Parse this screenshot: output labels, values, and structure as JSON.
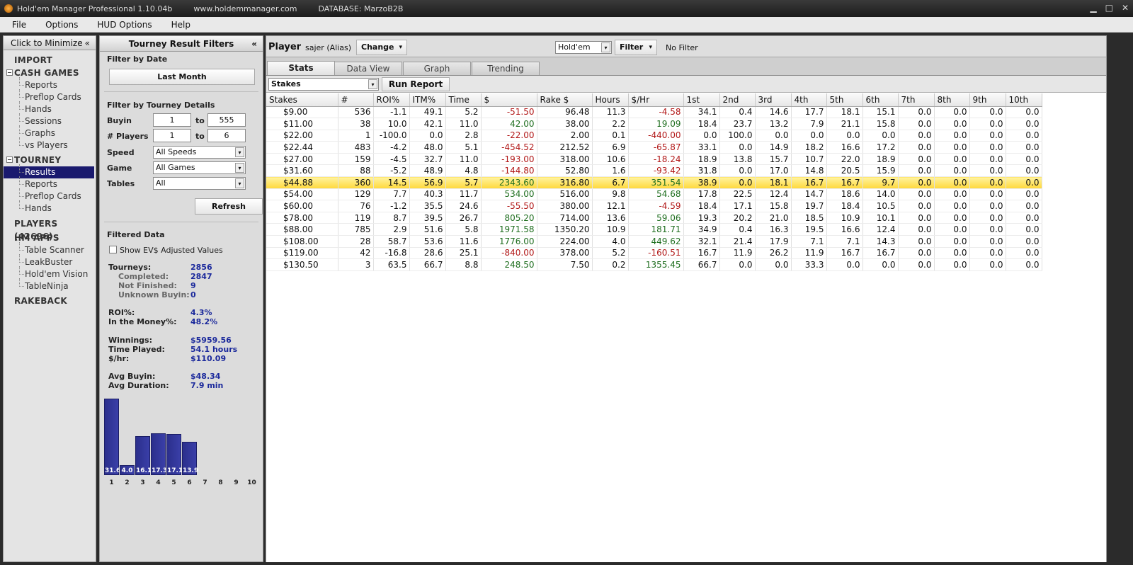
{
  "titlebar": {
    "app_title": "Hold'em Manager Professional 1.10.04b",
    "website": "www.holdemmanager.com",
    "database": "DATABASE: MarzoB2B",
    "minimize": "▁",
    "maximize": "□",
    "close": "✕"
  },
  "menu": [
    "File",
    "Options",
    "HUD Options",
    "Help"
  ],
  "nav": {
    "minimize_label": "Click to Minimize",
    "minimize_glyph": "«",
    "import": "IMPORT",
    "cash_games": "CASH GAMES",
    "cash_items": [
      "Reports",
      "Preflop Cards",
      "Hands",
      "Sessions",
      "Graphs",
      "vs Players"
    ],
    "tourney": "TOURNEY",
    "tourney_items": [
      "Results",
      "Reports",
      "Preflop Cards",
      "Hands"
    ],
    "players": "PLAYERS (42696)",
    "hm_apps": "HM APPS",
    "app_items": [
      "Table Scanner",
      "LeakBuster",
      "Hold'em Vision",
      "TableNinja"
    ],
    "rakeback": "RAKEBACK",
    "expander_glyph": "−"
  },
  "filters": {
    "title": "Tourney Result Filters",
    "collapse_glyph": "«",
    "by_date_label": "Filter by Date",
    "date_button": "Last Month",
    "by_details_label": "Filter by Tourney Details",
    "buyin_label": "Buyin",
    "buyin_from": "1",
    "buyin_to": "555",
    "to_label": "to",
    "players_label": "# Players",
    "players_from": "1",
    "players_to": "6",
    "speed_label": "Speed",
    "speed_value": "All Speeds",
    "game_label": "Game",
    "game_value": "All Games",
    "tables_label": "Tables",
    "tables_value": "All",
    "refresh": "Refresh",
    "filtered_data_label": "Filtered Data",
    "ev_checkbox_label": "Show EV$ Adjusted Values",
    "stats": {
      "tourneys_label": "Tourneys:",
      "tourneys": "2856",
      "completed_label": "Completed:",
      "completed": "2847",
      "not_finished_label": "Not Finished:",
      "not_finished": "9",
      "unknown_label": "Unknown Buyin:",
      "unknown": "0",
      "roi_label": "ROI%:",
      "roi": "4.3%",
      "itm_label": "In the Money%:",
      "itm": "48.2%",
      "winnings_label": "Winnings:",
      "winnings": "$5959.56",
      "time_label": "Time Played:",
      "time": "54.1 hours",
      "hr_label": "$/hr:",
      "hr": "$110.09",
      "avg_buyin_label": "Avg Buyin:",
      "avg_buyin": "$48.34",
      "avg_dur_label": "Avg Duration:",
      "avg_dur": "7.9 min"
    }
  },
  "chart_data": {
    "type": "bar",
    "categories": [
      "1",
      "2",
      "3",
      "4",
      "5",
      "6",
      "7",
      "8",
      "9",
      "10"
    ],
    "values": [
      31.6,
      4.0,
      16.1,
      17.3,
      17.1,
      13.9,
      0,
      0,
      0,
      0
    ],
    "labels": [
      "31.6",
      "4.0",
      "16.1",
      "17.3",
      "17.1",
      "13.9",
      "",
      "",
      "",
      ""
    ],
    "ylim": [
      0,
      31.6
    ]
  },
  "player": {
    "label": "Player",
    "alias": "sajer (Alias)",
    "change_button": "Change",
    "game_type": "Hold'em",
    "filter_button": "Filter",
    "filter_status": "No Filter",
    "dd_glyph": "▾"
  },
  "tabs": [
    "Stats",
    "Data View",
    "Graph",
    "Trending"
  ],
  "report": {
    "type": "Stakes",
    "run_button": "Run Report"
  },
  "table": {
    "columns": [
      "Stakes",
      "#",
      "ROI%",
      "ITM%",
      "Time",
      "$",
      "Rake $",
      "Hours",
      "$/Hr",
      "1st",
      "2nd",
      "3rd",
      "4th",
      "5th",
      "6th",
      "7th",
      "8th",
      "9th",
      "10th"
    ],
    "rows": [
      [
        "$9.00",
        "536",
        "-1.1",
        "49.1",
        "5.2",
        "-51.50",
        "96.48",
        "11.3",
        "-4.58",
        "34.1",
        "0.4",
        "14.6",
        "17.7",
        "18.1",
        "15.1",
        "0.0",
        "0.0",
        "0.0",
        "0.0"
      ],
      [
        "$11.00",
        "38",
        "10.0",
        "42.1",
        "11.0",
        "42.00",
        "38.00",
        "2.2",
        "19.09",
        "18.4",
        "23.7",
        "13.2",
        "7.9",
        "21.1",
        "15.8",
        "0.0",
        "0.0",
        "0.0",
        "0.0"
      ],
      [
        "$22.00",
        "1",
        "-100.0",
        "0.0",
        "2.8",
        "-22.00",
        "2.00",
        "0.1",
        "-440.00",
        "0.0",
        "100.0",
        "0.0",
        "0.0",
        "0.0",
        "0.0",
        "0.0",
        "0.0",
        "0.0",
        "0.0"
      ],
      [
        "$22.44",
        "483",
        "-4.2",
        "48.0",
        "5.1",
        "-454.52",
        "212.52",
        "6.9",
        "-65.87",
        "33.1",
        "0.0",
        "14.9",
        "18.2",
        "16.6",
        "17.2",
        "0.0",
        "0.0",
        "0.0",
        "0.0"
      ],
      [
        "$27.00",
        "159",
        "-4.5",
        "32.7",
        "11.0",
        "-193.00",
        "318.00",
        "10.6",
        "-18.24",
        "18.9",
        "13.8",
        "15.7",
        "10.7",
        "22.0",
        "18.9",
        "0.0",
        "0.0",
        "0.0",
        "0.0"
      ],
      [
        "$31.60",
        "88",
        "-5.2",
        "48.9",
        "4.8",
        "-144.80",
        "52.80",
        "1.6",
        "-93.42",
        "31.8",
        "0.0",
        "17.0",
        "14.8",
        "20.5",
        "15.9",
        "0.0",
        "0.0",
        "0.0",
        "0.0"
      ],
      [
        "$44.88",
        "360",
        "14.5",
        "56.9",
        "5.7",
        "2343.60",
        "316.80",
        "6.7",
        "351.54",
        "38.9",
        "0.0",
        "18.1",
        "16.7",
        "16.7",
        "9.7",
        "0.0",
        "0.0",
        "0.0",
        "0.0"
      ],
      [
        "$54.00",
        "129",
        "7.7",
        "40.3",
        "11.7",
        "534.00",
        "516.00",
        "9.8",
        "54.68",
        "17.8",
        "22.5",
        "12.4",
        "14.7",
        "18.6",
        "14.0",
        "0.0",
        "0.0",
        "0.0",
        "0.0"
      ],
      [
        "$60.00",
        "76",
        "-1.2",
        "35.5",
        "24.6",
        "-55.50",
        "380.00",
        "12.1",
        "-4.59",
        "18.4",
        "17.1",
        "15.8",
        "19.7",
        "18.4",
        "10.5",
        "0.0",
        "0.0",
        "0.0",
        "0.0"
      ],
      [
        "$78.00",
        "119",
        "8.7",
        "39.5",
        "26.7",
        "805.20",
        "714.00",
        "13.6",
        "59.06",
        "19.3",
        "20.2",
        "21.0",
        "18.5",
        "10.9",
        "10.1",
        "0.0",
        "0.0",
        "0.0",
        "0.0"
      ],
      [
        "$88.00",
        "785",
        "2.9",
        "51.6",
        "5.8",
        "1971.58",
        "1350.20",
        "10.9",
        "181.71",
        "34.9",
        "0.4",
        "16.3",
        "19.5",
        "16.6",
        "12.4",
        "0.0",
        "0.0",
        "0.0",
        "0.0"
      ],
      [
        "$108.00",
        "28",
        "58.7",
        "53.6",
        "11.6",
        "1776.00",
        "224.00",
        "4.0",
        "449.62",
        "32.1",
        "21.4",
        "17.9",
        "7.1",
        "7.1",
        "14.3",
        "0.0",
        "0.0",
        "0.0",
        "0.0"
      ],
      [
        "$119.00",
        "42",
        "-16.8",
        "28.6",
        "25.1",
        "-840.00",
        "378.00",
        "5.2",
        "-160.51",
        "16.7",
        "11.9",
        "26.2",
        "11.9",
        "16.7",
        "16.7",
        "0.0",
        "0.0",
        "0.0",
        "0.0"
      ],
      [
        "$130.50",
        "3",
        "63.5",
        "66.7",
        "8.8",
        "248.50",
        "7.50",
        "0.2",
        "1355.45",
        "66.7",
        "0.0",
        "0.0",
        "33.3",
        "0.0",
        "0.0",
        "0.0",
        "0.0",
        "0.0",
        "0.0"
      ]
    ],
    "highlighted_row": 6
  }
}
